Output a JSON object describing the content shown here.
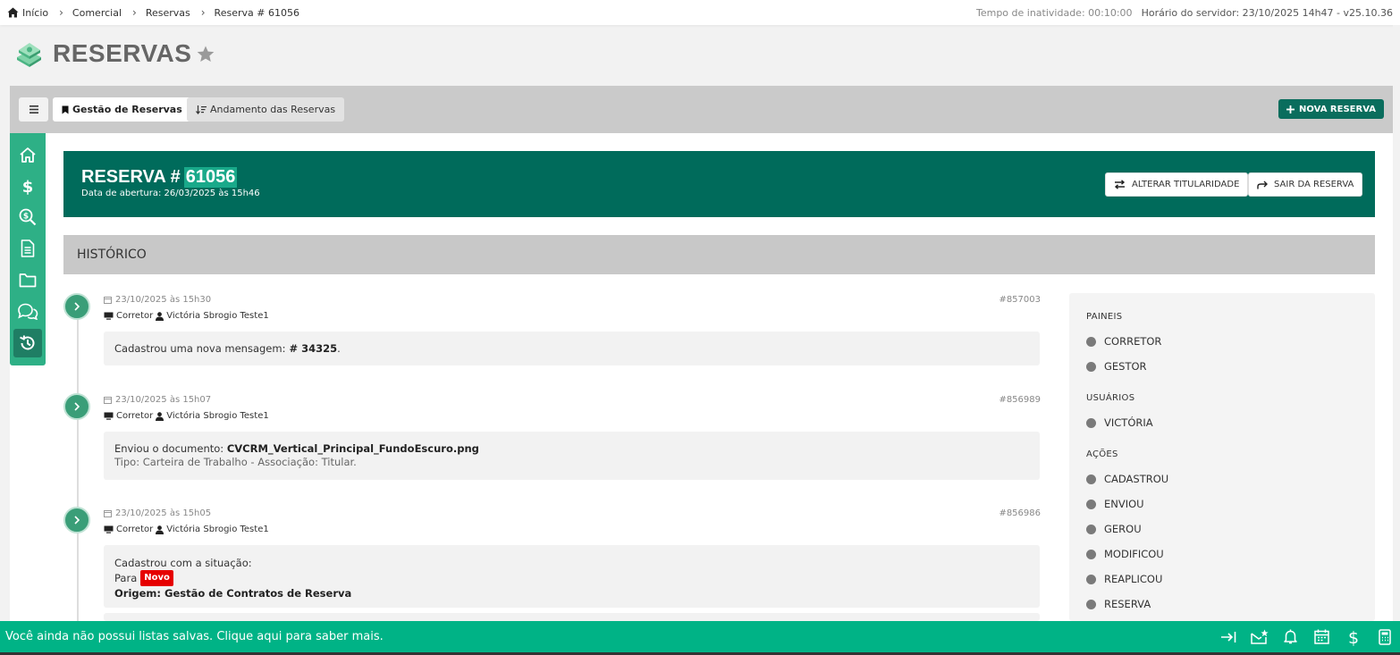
{
  "breadcrumb": {
    "items": [
      "Início",
      "Comercial",
      "Reservas",
      "Reserva # 61056"
    ]
  },
  "topbar": {
    "inactivity_label": "Tempo de inatividade: 00:10:00",
    "server_time": "Horário do servidor: 23/10/2025 14h47 - v25.10.36"
  },
  "page": {
    "title": "RESERVAS"
  },
  "tabs": {
    "active_label": "Gestão de Reservas",
    "inactive_label": "Andamento das Reservas",
    "new_button": "NOVA RESERVA"
  },
  "reserva": {
    "title_prefix": "RESERVA #",
    "number": "61056",
    "date_line": "Data de abertura: 26/03/2025 às 15h46",
    "btn_alterar": "ALTERAR TITULARIDADE",
    "btn_sair": "SAIR DA RESERVA"
  },
  "historico": {
    "title": "HISTÓRICO",
    "entries": [
      {
        "datetime": "23/10/2025 às 15h30",
        "id": "#857003",
        "role": "Corretor",
        "user": "Victória Sbrogio Teste1",
        "text": "Cadastrou uma nova mensagem: ",
        "text_bold": "# 34325",
        "text_end": "."
      },
      {
        "datetime": "23/10/2025 às 15h07",
        "id": "#856989",
        "role": "Corretor",
        "user": "Victória Sbrogio Teste1",
        "text": "Enviou o documento: ",
        "text_bold": "CVCRM_Vertical_Principal_FundoEscuro.png",
        "line2": "Tipo: Carteira de Trabalho - Associação: Titular."
      },
      {
        "datetime": "23/10/2025 às 15h05",
        "id": "#856986",
        "role": "Corretor",
        "user": "Victória Sbrogio Teste1",
        "line1": "Cadastrou com a situação:",
        "para": "Para",
        "badge": "Novo",
        "origem": "Origem: Gestão de Contratos de Reserva"
      }
    ]
  },
  "filters": {
    "paineis_title": "PAINEIS",
    "paineis": [
      "CORRETOR",
      "GESTOR"
    ],
    "usuarios_title": "USUÁRIOS",
    "usuarios": [
      "VICTÓRIA"
    ],
    "acoes_title": "AÇÕES",
    "acoes": [
      "CADASTROU",
      "ENVIOU",
      "GEROU",
      "MODIFICOU",
      "REAPLICOU",
      "RESERVA"
    ]
  },
  "bottombar": {
    "text": "Você ainda não possui listas salvas. Clique aqui para saber mais."
  },
  "colors": {
    "primary_dark": "#006b5b",
    "accent_green": "#00b386",
    "rail_green": "#2eb086",
    "badge_red": "#e60000"
  },
  "icons": {
    "rail": [
      "home-icon",
      "dollar-icon",
      "search-dollar-icon",
      "document-icon",
      "folder-icon",
      "chat-icon",
      "history-icon"
    ],
    "bottom": [
      "collapse-arrow-icon",
      "mail-star-icon",
      "bell-icon",
      "calendar-icon",
      "dollar-icon",
      "calculator-icon"
    ]
  }
}
